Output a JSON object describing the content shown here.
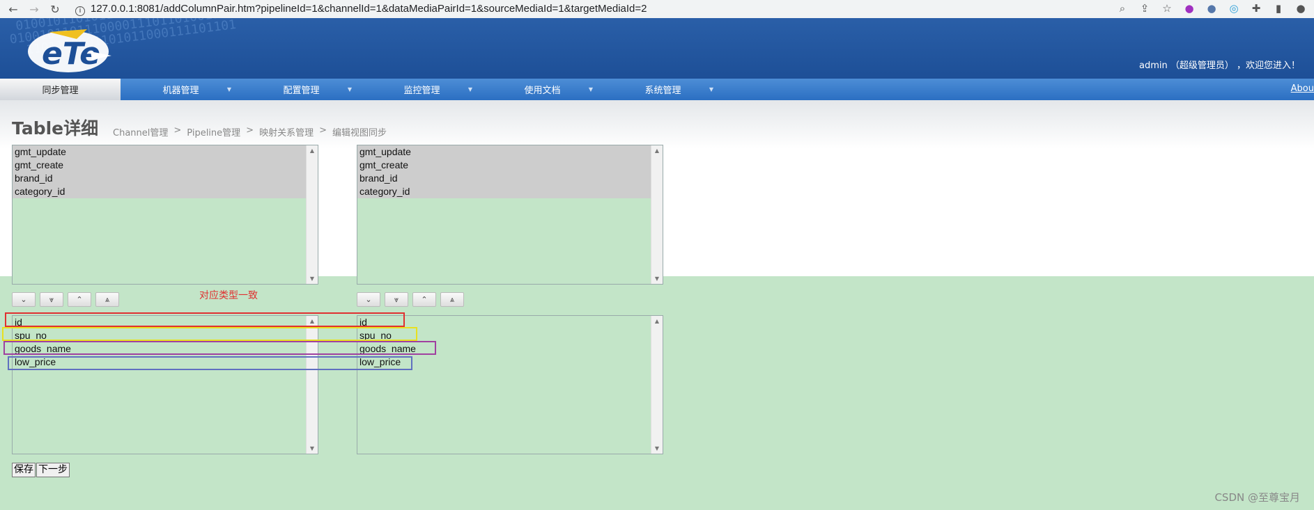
{
  "browser": {
    "url": "127.0.0.1:8081/addColumnPair.htm?pipelineId=1&channelId=1&dataMediaPairId=1&sourceMediaId=1&targetMediaId=2"
  },
  "header": {
    "user_info": "admin （超级管理员） ，欢迎您进入！"
  },
  "menu": {
    "items": [
      {
        "label": "同步管理"
      },
      {
        "label": "机器管理"
      },
      {
        "label": "配置管理"
      },
      {
        "label": "监控管理"
      },
      {
        "label": "使用文档"
      },
      {
        "label": "系统管理"
      }
    ],
    "about": "Abou"
  },
  "page": {
    "title": "Table详细",
    "breadcrumb": [
      "Channel管理",
      ">",
      "Pipeline管理",
      ">",
      "映射关系管理",
      ">",
      "编辑视图同步"
    ]
  },
  "source_unselected": [
    "gmt_update",
    "gmt_create",
    "brand_id",
    "category_id"
  ],
  "target_unselected": [
    "gmt_update",
    "gmt_create",
    "brand_id",
    "category_id"
  ],
  "source_selected": [
    "id",
    "spu_no",
    "goods_name",
    "low_price"
  ],
  "target_selected": [
    "id",
    "spu_no",
    "goods_name",
    "low_price"
  ],
  "annotation": "对应类型一致",
  "buttons": {
    "save": "保存",
    "next": "下一步"
  },
  "watermark": "CSDN @至尊宝月",
  "colors": {
    "page_bg": "#c3e5c8",
    "header": "#1d4f97",
    "highlight_red": "#e03030",
    "highlight_yellow": "#e8e020",
    "highlight_purple": "#a040a0",
    "highlight_blue": "#6070c0"
  }
}
